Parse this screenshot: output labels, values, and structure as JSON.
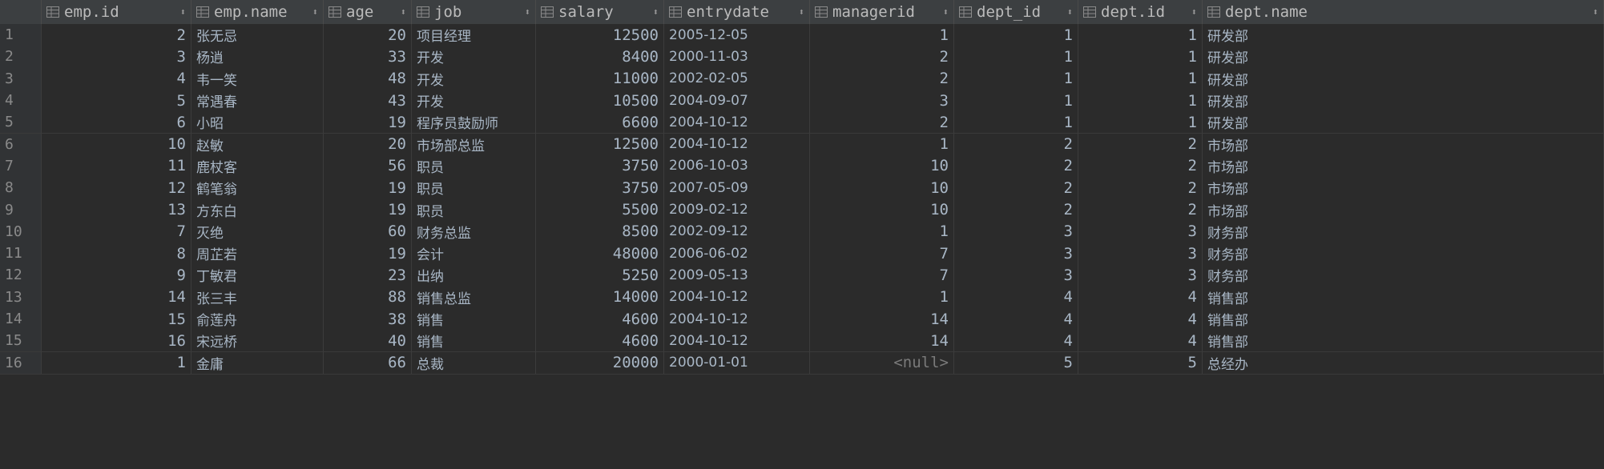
{
  "columns": [
    {
      "key": "emp_id",
      "label": "emp.id",
      "align": "num"
    },
    {
      "key": "emp_name",
      "label": "emp.name",
      "align": "txt"
    },
    {
      "key": "age",
      "label": "age",
      "align": "num"
    },
    {
      "key": "job",
      "label": "job",
      "align": "txt"
    },
    {
      "key": "salary",
      "label": "salary",
      "align": "num"
    },
    {
      "key": "entrydate",
      "label": "entrydate",
      "align": "txt"
    },
    {
      "key": "managerid",
      "label": "managerid",
      "align": "num"
    },
    {
      "key": "dept_id",
      "label": "dept_id",
      "align": "num"
    },
    {
      "key": "dept_id2",
      "label": "dept.id",
      "align": "num"
    },
    {
      "key": "dept_name",
      "label": "dept.name",
      "align": "txt"
    }
  ],
  "rows": [
    {
      "n": "1",
      "emp_id": "2",
      "emp_name": "张无忌",
      "age": "20",
      "job": "项目经理",
      "salary": "12500",
      "entrydate": "2005-12-05",
      "managerid": "1",
      "dept_id": "1",
      "dept_id2": "1",
      "dept_name": "研发部"
    },
    {
      "n": "2",
      "emp_id": "3",
      "emp_name": "杨逍",
      "age": "33",
      "job": "开发",
      "salary": "8400",
      "entrydate": "2000-11-03",
      "managerid": "2",
      "dept_id": "1",
      "dept_id2": "1",
      "dept_name": "研发部"
    },
    {
      "n": "3",
      "emp_id": "4",
      "emp_name": "韦一笑",
      "age": "48",
      "job": "开发",
      "salary": "11000",
      "entrydate": "2002-02-05",
      "managerid": "2",
      "dept_id": "1",
      "dept_id2": "1",
      "dept_name": "研发部"
    },
    {
      "n": "4",
      "emp_id": "5",
      "emp_name": "常遇春",
      "age": "43",
      "job": "开发",
      "salary": "10500",
      "entrydate": "2004-09-07",
      "managerid": "3",
      "dept_id": "1",
      "dept_id2": "1",
      "dept_name": "研发部"
    },
    {
      "n": "5",
      "emp_id": "6",
      "emp_name": "小昭",
      "age": "19",
      "job": "程序员鼓励师",
      "salary": "6600",
      "entrydate": "2004-10-12",
      "managerid": "2",
      "dept_id": "1",
      "dept_id2": "1",
      "dept_name": "研发部"
    },
    {
      "n": "6",
      "emp_id": "10",
      "emp_name": "赵敏",
      "age": "20",
      "job": "市场部总监",
      "salary": "12500",
      "entrydate": "2004-10-12",
      "managerid": "1",
      "dept_id": "2",
      "dept_id2": "2",
      "dept_name": "市场部"
    },
    {
      "n": "7",
      "emp_id": "11",
      "emp_name": "鹿杖客",
      "age": "56",
      "job": "职员",
      "salary": "3750",
      "entrydate": "2006-10-03",
      "managerid": "10",
      "dept_id": "2",
      "dept_id2": "2",
      "dept_name": "市场部"
    },
    {
      "n": "8",
      "emp_id": "12",
      "emp_name": "鹤笔翁",
      "age": "19",
      "job": "职员",
      "salary": "3750",
      "entrydate": "2007-05-09",
      "managerid": "10",
      "dept_id": "2",
      "dept_id2": "2",
      "dept_name": "市场部"
    },
    {
      "n": "9",
      "emp_id": "13",
      "emp_name": "方东白",
      "age": "19",
      "job": "职员",
      "salary": "5500",
      "entrydate": "2009-02-12",
      "managerid": "10",
      "dept_id": "2",
      "dept_id2": "2",
      "dept_name": "市场部"
    },
    {
      "n": "10",
      "emp_id": "7",
      "emp_name": "灭绝",
      "age": "60",
      "job": "财务总监",
      "salary": "8500",
      "entrydate": "2002-09-12",
      "managerid": "1",
      "dept_id": "3",
      "dept_id2": "3",
      "dept_name": "财务部"
    },
    {
      "n": "11",
      "emp_id": "8",
      "emp_name": "周芷若",
      "age": "19",
      "job": "会计",
      "salary": "48000",
      "entrydate": "2006-06-02",
      "managerid": "7",
      "dept_id": "3",
      "dept_id2": "3",
      "dept_name": "财务部"
    },
    {
      "n": "12",
      "emp_id": "9",
      "emp_name": "丁敏君",
      "age": "23",
      "job": "出纳",
      "salary": "5250",
      "entrydate": "2009-05-13",
      "managerid": "7",
      "dept_id": "3",
      "dept_id2": "3",
      "dept_name": "财务部"
    },
    {
      "n": "13",
      "emp_id": "14",
      "emp_name": "张三丰",
      "age": "88",
      "job": "销售总监",
      "salary": "14000",
      "entrydate": "2004-10-12",
      "managerid": "1",
      "dept_id": "4",
      "dept_id2": "4",
      "dept_name": "销售部"
    },
    {
      "n": "14",
      "emp_id": "15",
      "emp_name": "俞莲舟",
      "age": "38",
      "job": "销售",
      "salary": "4600",
      "entrydate": "2004-10-12",
      "managerid": "14",
      "dept_id": "4",
      "dept_id2": "4",
      "dept_name": "销售部"
    },
    {
      "n": "15",
      "emp_id": "16",
      "emp_name": "宋远桥",
      "age": "40",
      "job": "销售",
      "salary": "4600",
      "entrydate": "2004-10-12",
      "managerid": "14",
      "dept_id": "4",
      "dept_id2": "4",
      "dept_name": "销售部"
    },
    {
      "n": "16",
      "emp_id": "1",
      "emp_name": "金庸",
      "age": "66",
      "job": "总裁",
      "salary": "20000",
      "entrydate": "2000-01-01",
      "managerid": "<null>",
      "dept_id": "5",
      "dept_id2": "5",
      "dept_name": "总经办"
    }
  ],
  "icons": {
    "column": "table-column-icon",
    "sort": "sort-icon"
  },
  "colors": {
    "background": "#2b2b2b",
    "header": "#3c3f41",
    "text": "#a9b7c6",
    "null": "#7a7a7a"
  }
}
